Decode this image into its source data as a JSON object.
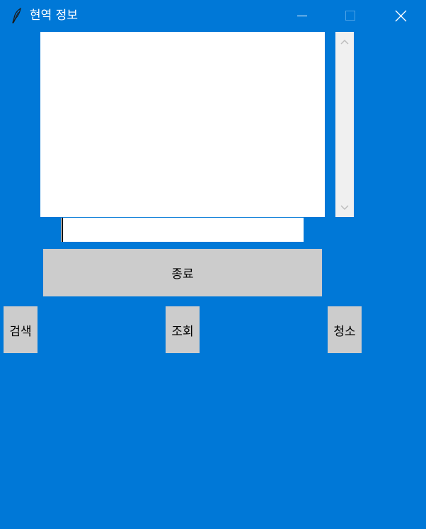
{
  "window": {
    "title": "현역 정보",
    "app_icon": "feather-icon",
    "controls": {
      "minimize_icon": "minimize-icon",
      "maximize_icon": "maximize-icon",
      "close_icon": "close-icon"
    }
  },
  "listbox": {
    "items": []
  },
  "entry": {
    "value": ""
  },
  "buttons": {
    "quit": "종료",
    "search": "검색",
    "view": "조회",
    "clear": "청소"
  },
  "colors": {
    "background": "#0078D7",
    "button": "#CCCCCC",
    "scrollbar": "#F0F0F0"
  }
}
